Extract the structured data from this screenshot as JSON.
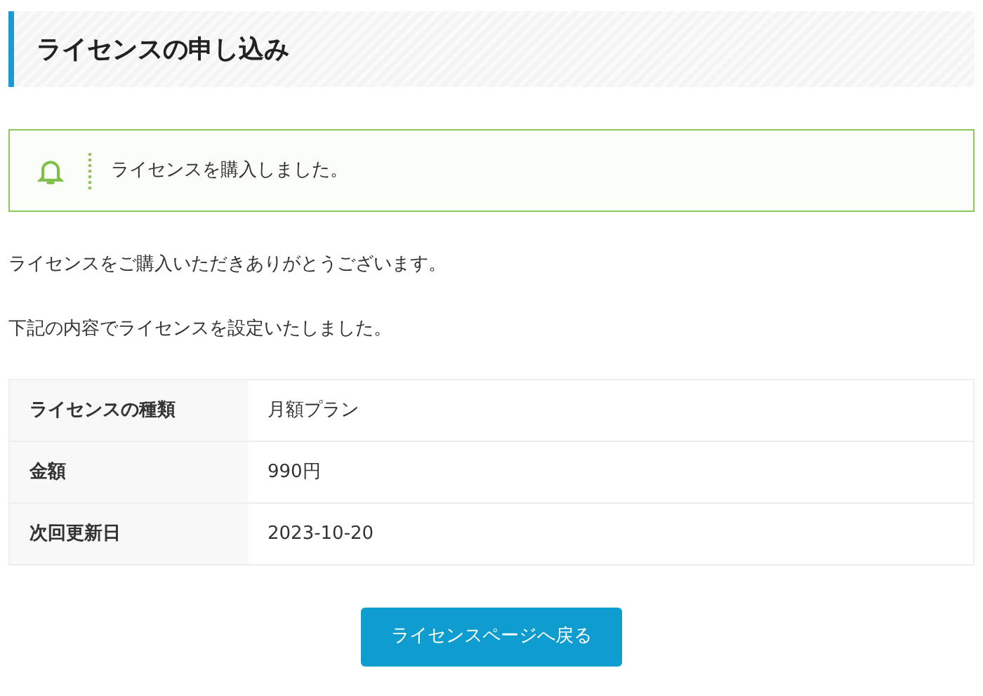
{
  "heading": "ライセンスの申し込み",
  "notice": {
    "message": "ライセンスを購入しました。"
  },
  "paragraphs": [
    "ライセンスをご購入いただきありがとうございます。",
    "下記の内容でライセンスを設定いたしました。"
  ],
  "table": {
    "rows": [
      {
        "label": "ライセンスの種類",
        "value": "月額プラン"
      },
      {
        "label": "金額",
        "value": "990円"
      },
      {
        "label": "次回更新日",
        "value": "2023-10-20"
      }
    ]
  },
  "button": "ライセンスページへ戻る"
}
